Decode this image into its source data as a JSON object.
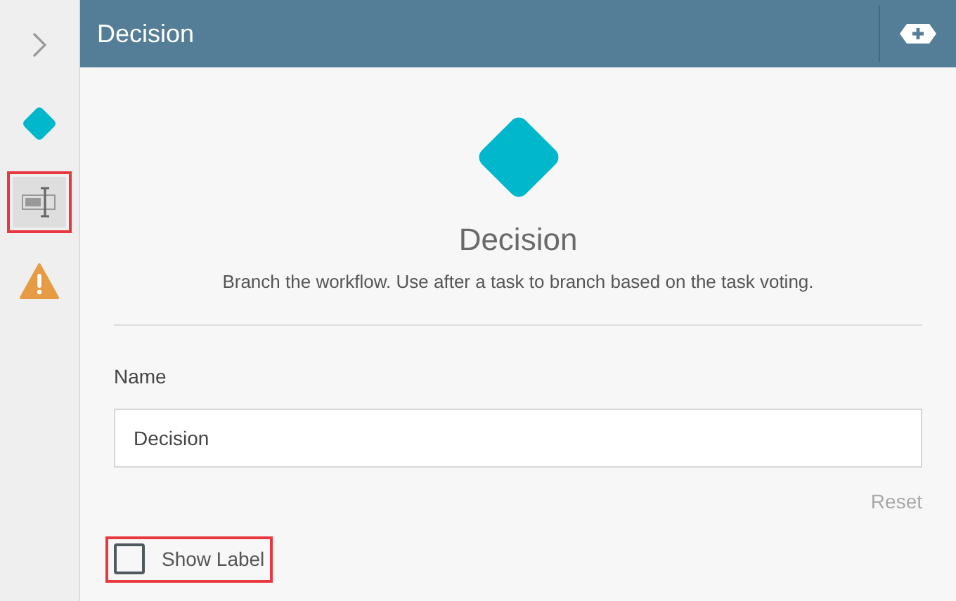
{
  "sidebar": {
    "items": [
      {
        "kind": "expand",
        "selected": false,
        "highlighted": false
      },
      {
        "kind": "diamond",
        "selected": false,
        "highlighted": false
      },
      {
        "kind": "label",
        "selected": true,
        "highlighted": true
      },
      {
        "kind": "warning",
        "selected": false,
        "highlighted": false
      }
    ]
  },
  "header": {
    "title": "Decision"
  },
  "summary": {
    "title": "Decision",
    "description": "Branch the workflow. Use after a task to branch based on the task voting."
  },
  "name_field": {
    "label": "Name",
    "value": "Decision"
  },
  "reset": {
    "label": "Reset",
    "disabled": true
  },
  "show_label": {
    "label": "Show Label",
    "checked": false,
    "highlighted": true
  }
}
